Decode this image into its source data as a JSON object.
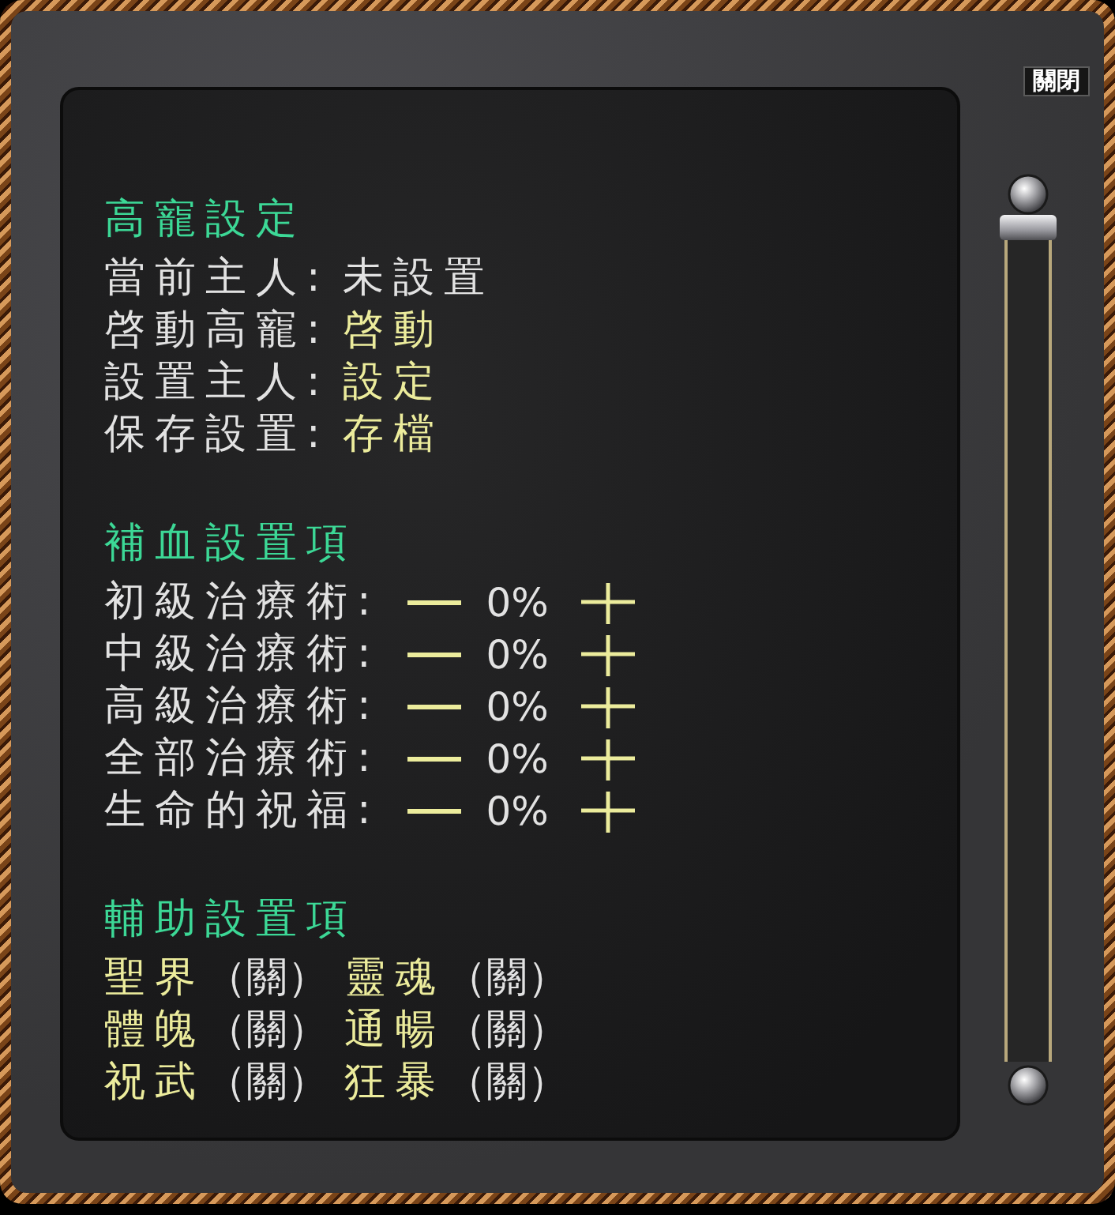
{
  "close_button": {
    "label": "關閉"
  },
  "pet_settings": {
    "title": "高寵設定",
    "rows": [
      {
        "label": "當前主人:",
        "value": "未設置",
        "kind": "status"
      },
      {
        "label": "啓動高寵:",
        "value": "啓動",
        "kind": "action"
      },
      {
        "label": "設置主人:",
        "value": "設定",
        "kind": "action"
      },
      {
        "label": "保存設置:",
        "value": "存檔",
        "kind": "action"
      }
    ]
  },
  "heal_settings": {
    "title": "補血設置項",
    "rows": [
      {
        "label": "初級治療術:",
        "value": "0%"
      },
      {
        "label": "中級治療術:",
        "value": "0%"
      },
      {
        "label": "高級治療術:",
        "value": "0%"
      },
      {
        "label": "全部治療術:",
        "value": "0%"
      },
      {
        "label": "生命的祝福:",
        "value": "0%"
      }
    ]
  },
  "support_settings": {
    "title": "輔助設置項",
    "rows": [
      {
        "items": [
          {
            "name": "聖界",
            "status": "（關）"
          },
          {
            "name": "靈魂",
            "status": "（關）"
          }
        ]
      },
      {
        "items": [
          {
            "name": "體魄",
            "status": "（關）"
          },
          {
            "name": "通暢",
            "status": "（關）"
          }
        ]
      },
      {
        "items": [
          {
            "name": "祝武",
            "status": "（關）"
          },
          {
            "name": "狂暴",
            "status": "（關）"
          }
        ]
      }
    ]
  }
}
